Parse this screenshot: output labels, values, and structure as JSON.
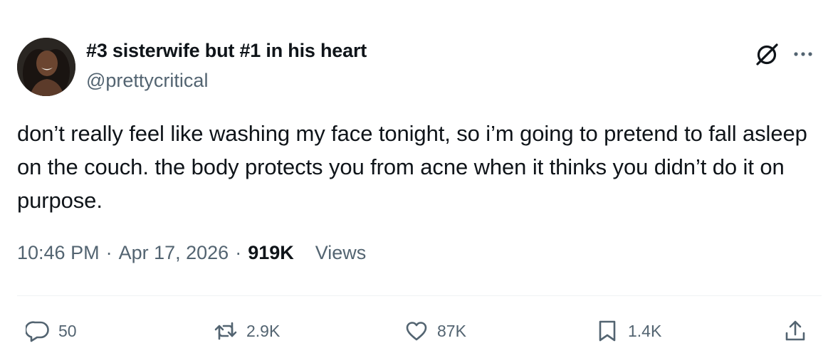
{
  "author": {
    "display_name": "#3 sisterwife but #1 in his heart",
    "handle": "@prettycritical"
  },
  "tweet": {
    "text": "don’t really feel like washing my face tonight, so i’m going to pretend to fall asleep on the couch. the body protects you from acne when it thinks you didn’t do it on purpose."
  },
  "meta": {
    "time": "10:46 PM",
    "separator": "·",
    "date": "Apr 17, 2026",
    "views_count": "919K",
    "views_label": "Views"
  },
  "actions": {
    "replies": "50",
    "reposts": "2.9K",
    "likes": "87K",
    "bookmarks": "1.4K"
  },
  "icons": {
    "top_right": [
      "grok-icon",
      "more-icon"
    ],
    "action_bar": [
      "reply-icon",
      "repost-icon",
      "like-icon",
      "bookmark-icon",
      "share-icon"
    ]
  },
  "colors": {
    "text_primary": "#0f1419",
    "text_secondary": "#536471",
    "divider": "#eff3f4"
  }
}
